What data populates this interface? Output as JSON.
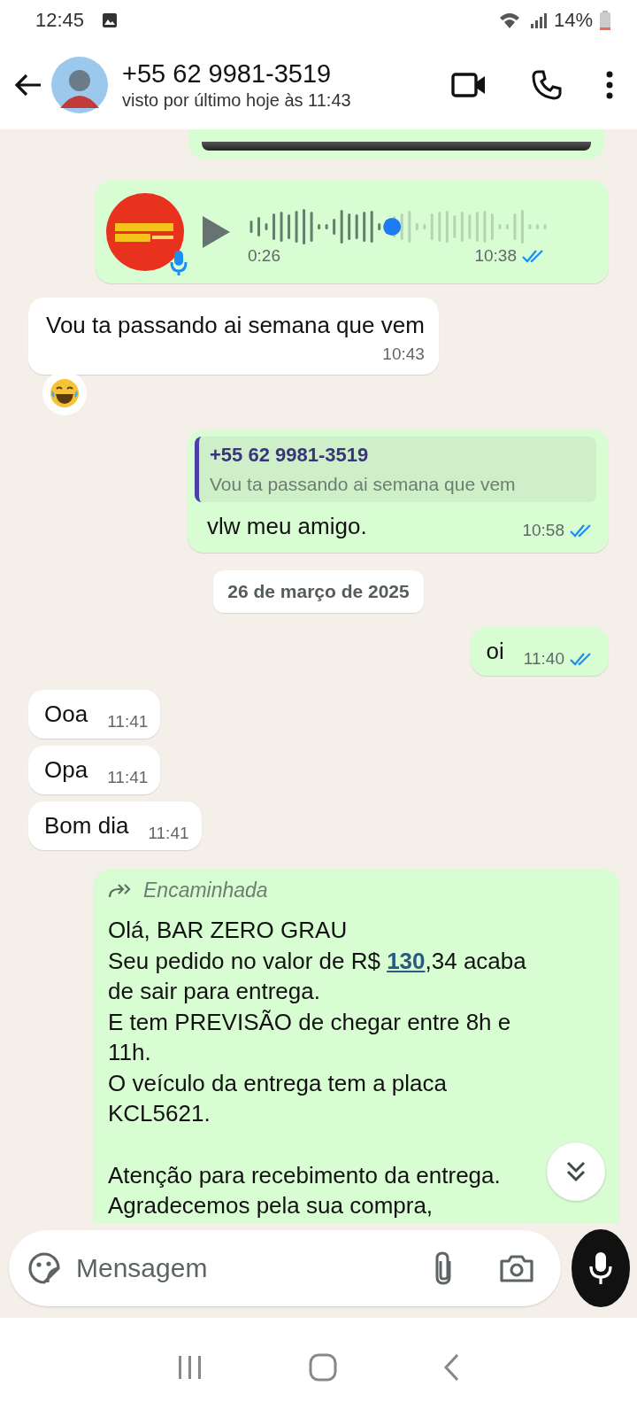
{
  "status_bar": {
    "time": "12:45",
    "battery": "14%"
  },
  "header": {
    "name": "+55 62 9981-3519",
    "last_seen": "visto por último hoje às 11:43"
  },
  "messages": [
    {
      "kind": "media",
      "outgoing": true
    },
    {
      "kind": "audio",
      "outgoing": true,
      "duration": "0:26",
      "time": "10:38",
      "read": true,
      "level": 0.48
    },
    {
      "kind": "text",
      "outgoing": false,
      "text": "Vou ta passando ai semana que vem",
      "time": "10:43",
      "reaction": true
    },
    {
      "kind": "reply",
      "outgoing": true,
      "quote_author": "+55 62 9981-3519",
      "quote_text": "Vou ta passando ai semana que vem",
      "text": "vlw meu amigo.",
      "time": "10:58",
      "read": true
    },
    {
      "kind": "date",
      "text": "26 de março de 2025"
    },
    {
      "kind": "short",
      "outgoing": true,
      "text": "oi",
      "time": "11:40",
      "read": true
    },
    {
      "kind": "short",
      "outgoing": false,
      "text": "Ooa",
      "time": "11:41"
    },
    {
      "kind": "short",
      "outgoing": false,
      "text": "Opa",
      "time": "11:41"
    },
    {
      "kind": "short",
      "outgoing": false,
      "text": "Bom dia",
      "time": "11:41"
    },
    {
      "kind": "forwarded",
      "outgoing": true,
      "label": "Encaminhada",
      "text": "Olá, BAR ZERO GRAU\nSeu pedido no valor de R$ **130**,34 acaba de sair para entrega.\nE tem PREVISÃO de chegar entre 8h e 11h.\nO veículo da entrega tem a placa KCL5621.\n\nAtenção para recebimento da entrega.\nAgradecemos pela sua compra,"
    }
  ],
  "input": {
    "placeholder": "Mensagem"
  }
}
